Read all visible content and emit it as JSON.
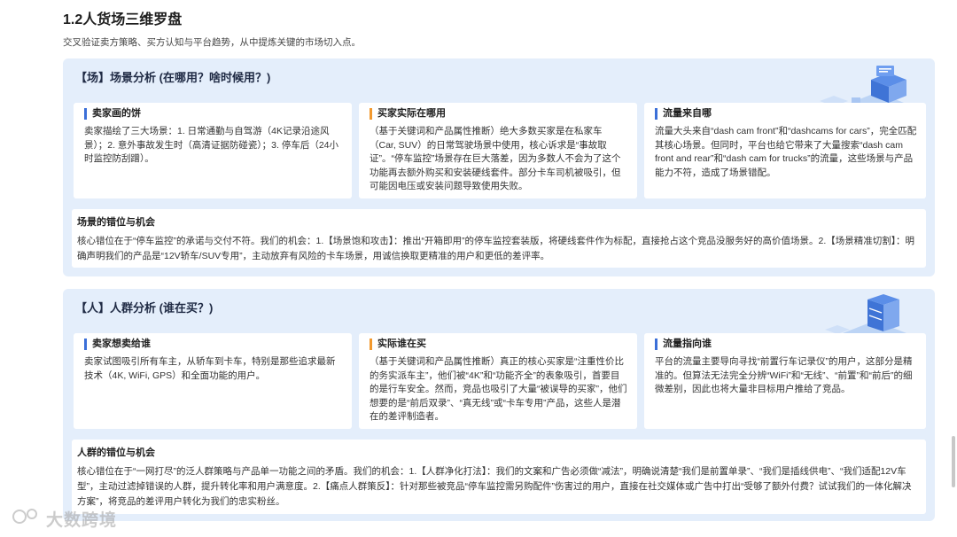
{
  "section": {
    "title": "1.2人货场三维罗盘",
    "subtitle": "交叉验证卖方策略、买方认知与平台趋势，从中提炼关键的市场切入点。"
  },
  "cards": [
    {
      "heading": "【场】场景分析 (在哪用？啥时候用？)",
      "columns": [
        {
          "title": "卖家画的饼",
          "body": "卖家描绘了三大场景：1. 日常通勤与自驾游（4K记录沿途风景）；2. 意外事故发生时（高清证据防碰瓷）；3. 停车后（24小时监控防刮蹭）。"
        },
        {
          "title": "买家实际在哪用",
          "body": "（基于关键词和产品属性推断）绝大多数买家是在私家车（Car, SUV）的日常驾驶场景中使用，核心诉求是“事故取证”。“停车监控”场景存在巨大落差，因为多数人不会为了这个功能再去额外购买和安装硬线套件。部分卡车司机被吸引，但可能因电压或安装问题导致使用失败。"
        },
        {
          "title": "流量来自哪",
          "body": "流量大头来自“dash cam front”和“dashcams for cars”，完全匹配其核心场景。但同时，平台也给它带来了大量搜索“dash cam front and rear”和“dash cam for trucks”的流量，这些场景与产品能力不符，造成了场景错配。"
        }
      ],
      "opportunity": {
        "title": "场景的错位与机会",
        "body": "核心错位在于“停车监控”的承诺与交付不符。我们的机会：1.【场景饱和攻击】：推出“开箱即用”的停车监控套装版，将硬线套件作为标配，直接抢占这个竞品没服务好的高价值场景。2.【场景精准切割】：明确声明我们的产品是“12V轿车/SUV专用”，主动放弃有风险的卡车场景，用诚信换取更精准的用户和更低的差评率。"
      }
    },
    {
      "heading": "【人】人群分析 (谁在买？)",
      "columns": [
        {
          "title": "卖家想卖给谁",
          "body": "卖家试图吸引所有车主，从轿车到卡车，特别是那些追求最新技术（4K, WiFi, GPS）和全面功能的用户。"
        },
        {
          "title": "实际谁在买",
          "body": "（基于关键词和产品属性推断）真正的核心买家是“注重性价比的务实派车主”，他们被“4K”和“功能齐全”的表象吸引，首要目的是行车安全。然而，竞品也吸引了大量“被误导的买家”，他们想要的是“前后双录”、“真无线”或“卡车专用”产品，这些人是潜在的差评制造者。"
        },
        {
          "title": "流量指向谁",
          "body": "平台的流量主要导向寻找“前置行车记录仪”的用户，这部分是精准的。但算法无法完全分辨“WiFi”和“无线”、“前置”和“前后”的细微差别，因此也将大量非目标用户推给了竞品。"
        }
      ],
      "opportunity": {
        "title": "人群的错位与机会",
        "body": "核心错位在于“一网打尽”的泛人群策略与产品单一功能之间的矛盾。我们的机会：1.【人群净化打法】：我们的文案和广告必须做“减法”，明确说清楚“我们是前置单录”、“我们是插线供电”、“我们适配12V车型”，主动过滤掉错误的人群，提升转化率和用户满意度。2.【痛点人群策反】：针对那些被竞品“停车监控需另购配件”伤害过的用户，直接在社交媒体或广告中打出“受够了额外付费？试试我们的一体化解决方案”，将竞品的差评用户转化为我们的忠实粉丝。"
      }
    }
  ],
  "watermark": "大数跨境",
  "colors": {
    "card_bg": "#e4eefb",
    "accent_blue": "#3b6fd8",
    "accent_orange": "#f2992e"
  }
}
